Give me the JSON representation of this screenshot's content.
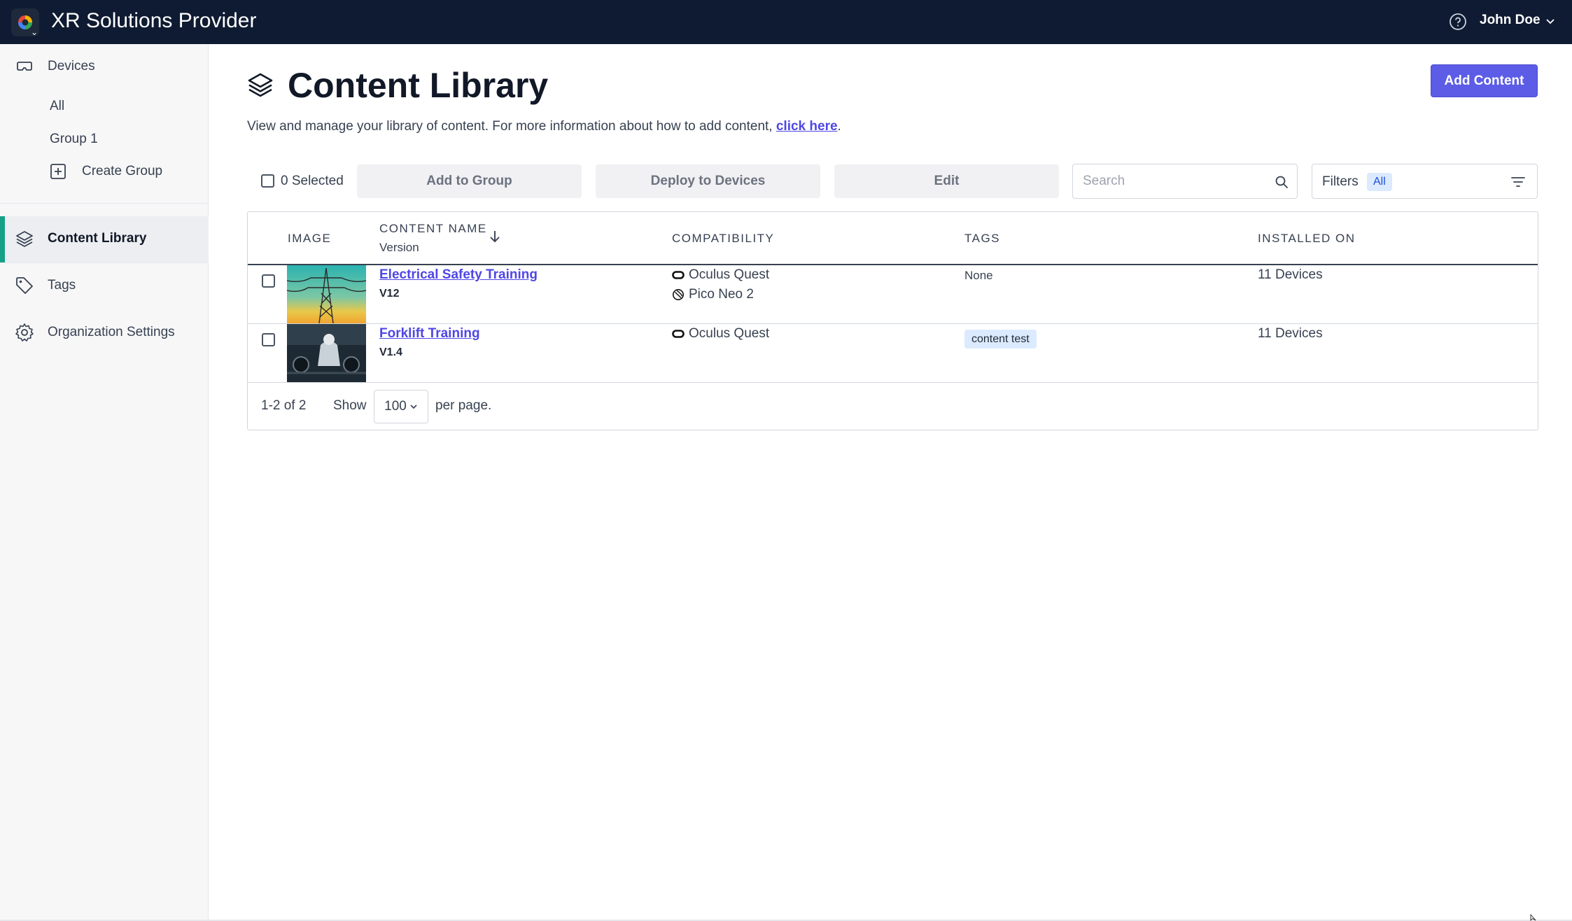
{
  "app": {
    "title": "XR Solutions Provider",
    "user_name": "John Doe",
    "colors": {
      "topbar": "#0f1b32",
      "accent": "#5c5ce6",
      "sidebar_active": "#16a085",
      "link": "#4f46e5",
      "tag_bg": "#dbeafe"
    }
  },
  "sidebar": {
    "devices": {
      "label": "Devices",
      "icon": "vr-headset-icon"
    },
    "devices_children": [
      {
        "label": "All"
      },
      {
        "label": "Group 1"
      },
      {
        "label": "Create Group",
        "icon": "plus-square-icon"
      }
    ],
    "content_library": {
      "label": "Content Library",
      "icon": "layers-icon",
      "active": true
    },
    "tags": {
      "label": "Tags",
      "icon": "tag-icon"
    },
    "organization_settings": {
      "label": "Organization Settings",
      "icon": "gear-icon"
    }
  },
  "page": {
    "title": "Content Library",
    "description": "View and manage your library of content. For more information about how to add content, ",
    "link_text": "click here",
    "description_end": ".",
    "add_button": "Add Content"
  },
  "toolbar": {
    "selected_label": "0 Selected",
    "add_to_group": "Add to Group",
    "deploy_to_devices": "Deploy to Devices",
    "edit": "Edit",
    "search_placeholder": "Search",
    "filters_label": "Filters",
    "filters_badge": "All"
  },
  "table": {
    "headers": {
      "image": "IMAGE",
      "content_name": "CONTENT NAME",
      "content_name_sub": "Version",
      "compatibility": "COMPATIBILITY",
      "tags": "TAGS",
      "installed_on": "INSTALLED ON"
    },
    "rows": [
      {
        "name": "Electrical Safety Training",
        "version": "V12",
        "compatibility": [
          "Oculus Quest",
          "Pico Neo 2"
        ],
        "tags": "None",
        "installed_on": "11 Devices"
      },
      {
        "name": "Forklift Training",
        "version": "V1.4",
        "compatibility": [
          "Oculus Quest"
        ],
        "tags": "content test",
        "installed_on": "11 Devices"
      }
    ]
  },
  "pagination": {
    "range": "1-2 of 2",
    "show_label": "Show",
    "per_page_value": "100",
    "per_page_label": "per page."
  }
}
